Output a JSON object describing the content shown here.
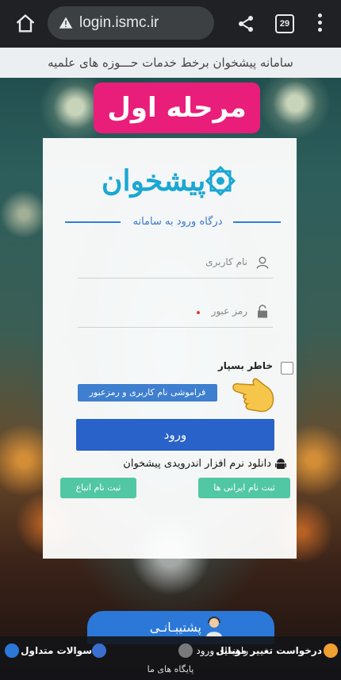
{
  "browser": {
    "url": "login.ismc.ir",
    "tab_count": "29"
  },
  "header": {
    "site_title": "سامانه پیشخوان برخط خدمات حـــوزه های علمیه"
  },
  "step_badge": "مرحله اول",
  "logo": {
    "text": "پیشخوان"
  },
  "login": {
    "portal_title": "درگاه ورود به سامانه",
    "username_label": "نام کاربری",
    "password_label": "رمز عبور",
    "remember_label": "خاطر بسپار",
    "forgot_label": "فراموشی نام کاربری و رمزعبور",
    "submit_label": "ورود",
    "android_label": "دانلود نرم افزار اندرویدی پیشخوان",
    "register_iranian_label": "ثبت نام ایرانی ها",
    "register_foreign_label": "ثبت نام اتباع"
  },
  "support": {
    "label": "پشتیبـانـی"
  },
  "footer": {
    "change_mobile": "درخواست تغییر موبایل",
    "login_guide": "راهنمای ورود",
    "faq": "سوالات متداول",
    "sites": "پایگاه های ما"
  },
  "colors": {
    "badge": "#e91e7a",
    "primary": "#2962c8",
    "register": "#52c7a3",
    "brand": "#1aa7d3"
  }
}
